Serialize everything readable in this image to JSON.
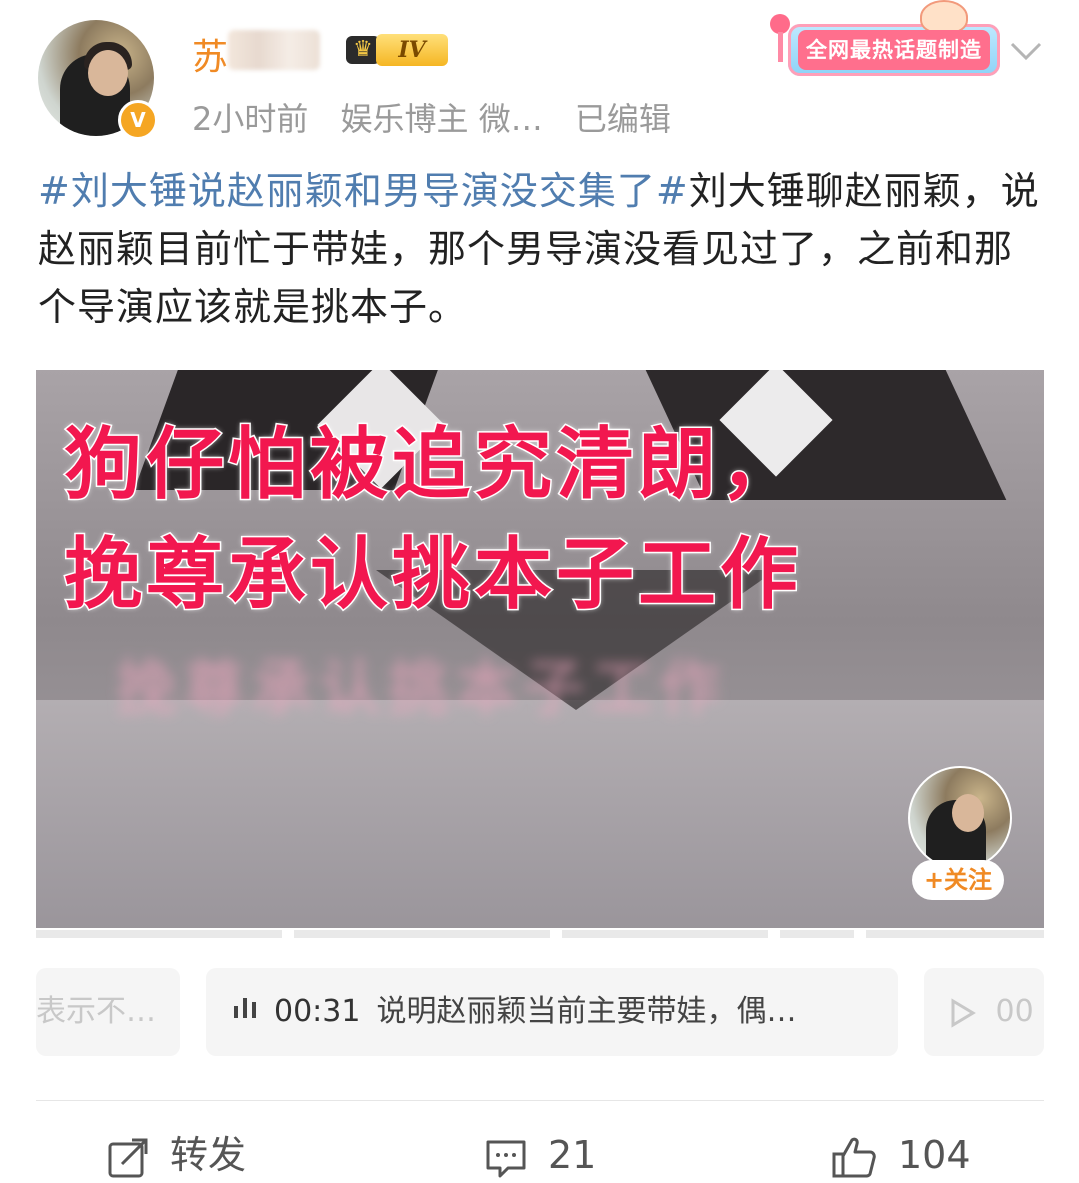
{
  "header": {
    "username": "苏",
    "level": "IV",
    "meta": {
      "time": "2小时前",
      "source": "娱乐博主 微…",
      "edited": "已编辑"
    },
    "promo_label": "全网最热话题制造机"
  },
  "post": {
    "hashtag": "#刘大锤说赵丽颖和男导演没交集了#",
    "text": "刘大锤聊赵丽颖，说赵丽颖目前忙于带娃，那个男导演没看见过了，之前和那个导演应该就是挑本子。"
  },
  "media": {
    "caption_line1": "狗仔怕被追究清朗，",
    "caption_line2": "挽尊承认挑本子工作",
    "follow_label": "+关注"
  },
  "chips": {
    "left": "表示不…",
    "main_time": "00:31",
    "main_text": "说明赵丽颖当前主要带娃，偶…",
    "right": "00"
  },
  "footer": {
    "repost_label": "转发",
    "comment_count": "21",
    "like_count": "104"
  },
  "colors": {
    "hashtag": "#507daf",
    "username": "#f08a24",
    "caption": "#f2174f",
    "meta": "#9a9a9a"
  }
}
